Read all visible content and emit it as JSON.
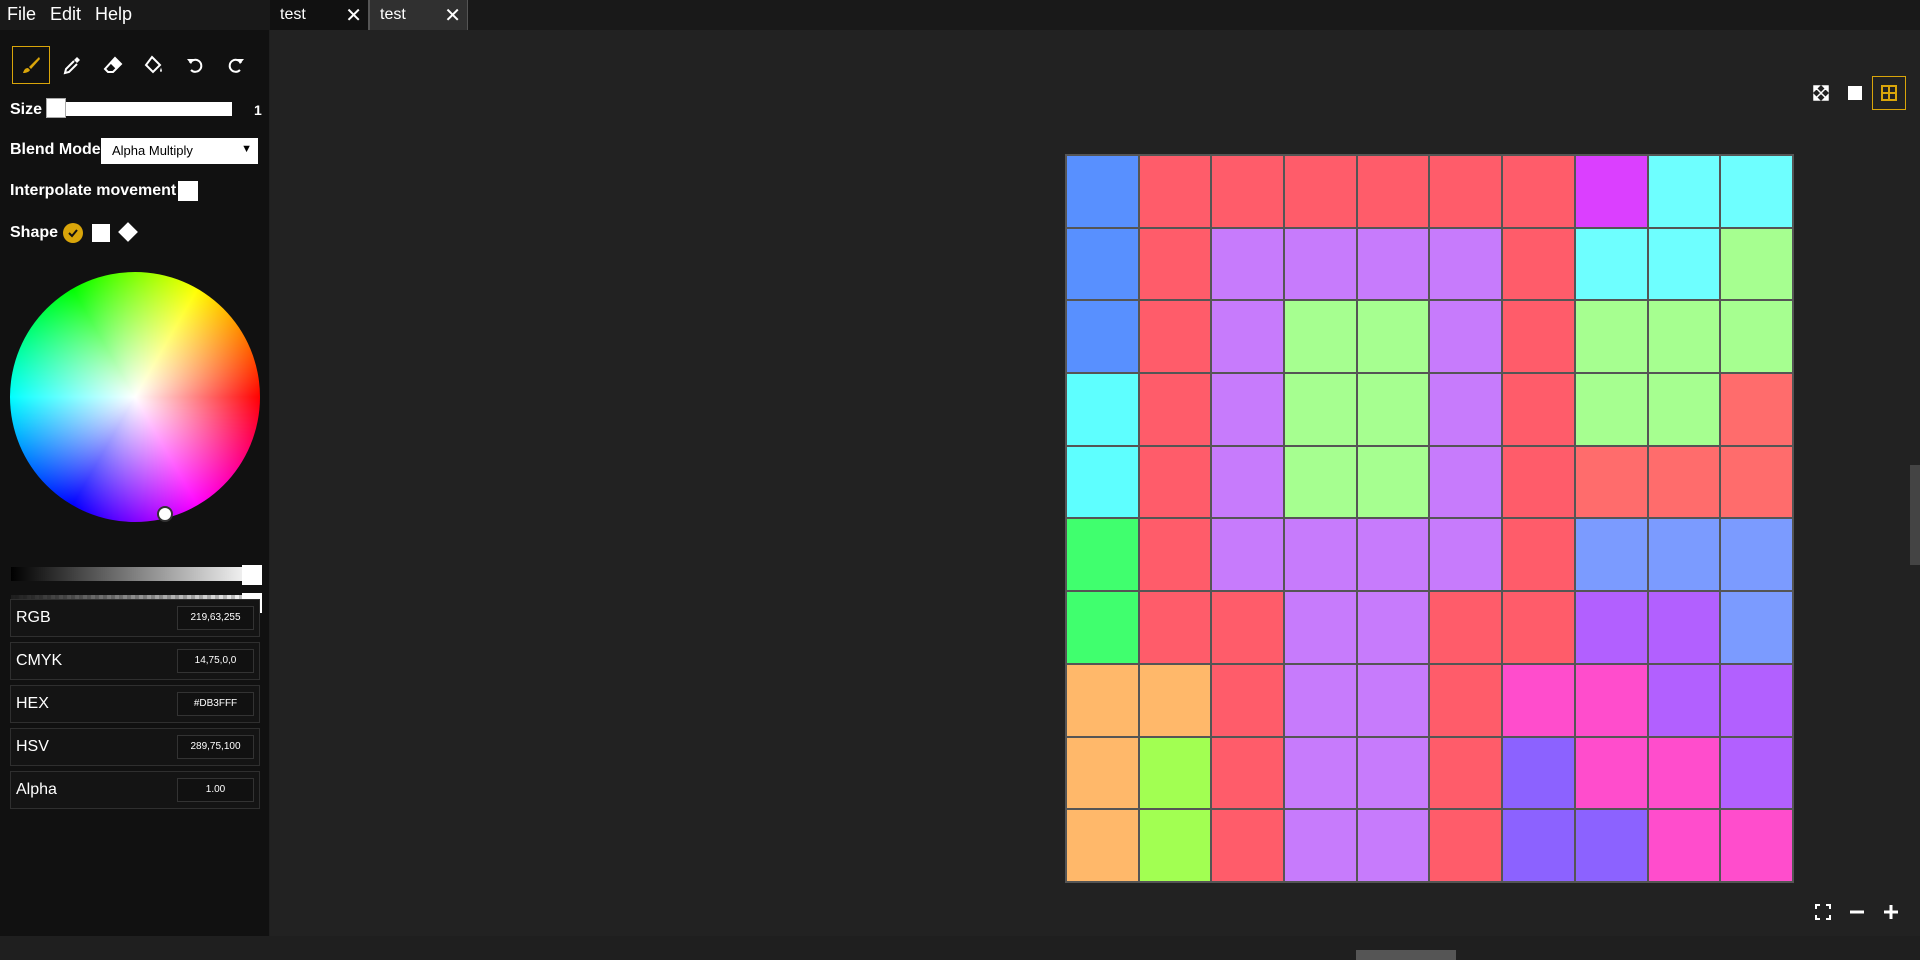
{
  "menu": [
    "File",
    "Edit",
    "Help"
  ],
  "tabs": [
    {
      "label": "test"
    },
    {
      "label": "test"
    }
  ],
  "tools": [
    {
      "name": "brush-tool",
      "icon": "brush-icon",
      "active": true
    },
    {
      "name": "eyedropper-tool",
      "icon": "eyedropper-icon",
      "active": false
    },
    {
      "name": "eraser-tool",
      "icon": "eraser-icon",
      "active": false
    },
    {
      "name": "fill-tool",
      "icon": "paint-bucket-icon",
      "active": false
    },
    {
      "name": "undo-button",
      "icon": "undo-icon",
      "active": false
    },
    {
      "name": "redo-button",
      "icon": "redo-icon",
      "active": false
    }
  ],
  "controls": {
    "size_label": "Size",
    "size_value": "1",
    "blend_label": "Blend Mode",
    "blend_value": "Alpha Multiply",
    "interpolate_label": "Interpolate movement",
    "shape_label": "Shape"
  },
  "color_fields": [
    {
      "label": "RGB",
      "value": "219,63,255"
    },
    {
      "label": "CMYK",
      "value": "14,75,0,0"
    },
    {
      "label": "HEX",
      "value": "#DB3FFF"
    },
    {
      "label": "HSV",
      "value": "289,75,100"
    },
    {
      "label": "Alpha",
      "value": "1.00"
    }
  ],
  "accent_color": "#d9a50a",
  "palette": {
    "B": "#5890ff",
    "R": "#ff5c6a",
    "P": "#c77bfc",
    "M": "#db3fff",
    "C": "#6effff",
    "G": "#a6ff90",
    "K": "#5effff",
    "E": "#40ff6e",
    "S": "#ff6c6c",
    "L": "#7b9bff",
    "V": "#b260ff",
    "O": "#ffb86a",
    "Y": "#a2ff52",
    "H": "#ff4dcc",
    "I": "#8c62ff"
  },
  "grid": [
    "BRRRRRRMCC",
    "BRPPPPRCCG",
    "BRPGGPRGGG",
    "KRPGGPRGGS",
    "KRPGGPRSSS",
    "ERPPPPRLLL",
    "ERRPPRRVVL",
    "OORPPRHHVV",
    "OYRPPRIHHV",
    "OYRPPRIIHH"
  ]
}
